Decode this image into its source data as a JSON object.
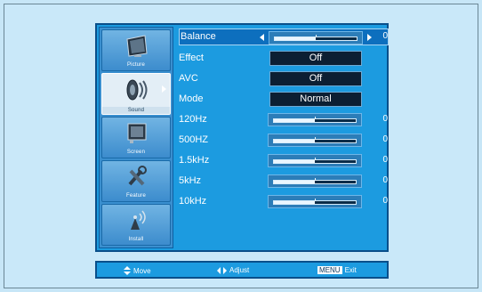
{
  "sidebar": {
    "items": [
      {
        "label": "Picture",
        "icon": "picture-icon"
      },
      {
        "label": "Sound",
        "icon": "sound-icon"
      },
      {
        "label": "Screen",
        "icon": "screen-icon"
      },
      {
        "label": "Feature",
        "icon": "feature-icon"
      },
      {
        "label": "Install",
        "icon": "install-icon"
      }
    ]
  },
  "menu": {
    "balance": {
      "label": "Balance",
      "value": "0",
      "level": 0.5
    },
    "effect": {
      "label": "Effect",
      "value": "Off"
    },
    "avc": {
      "label": "AVC",
      "value": "Off"
    },
    "mode": {
      "label": "Mode",
      "value": "Normal"
    },
    "eq": [
      {
        "label": "120Hz",
        "value": "0",
        "level": 0.5
      },
      {
        "label": "500HZ",
        "value": "0",
        "level": 0.5
      },
      {
        "label": "1.5kHz",
        "value": "0",
        "level": 0.5
      },
      {
        "label": "5kHz",
        "value": "0",
        "level": 0.5
      },
      {
        "label": "10kHz",
        "value": "0",
        "level": 0.5
      }
    ]
  },
  "footer": {
    "move": "Move",
    "adjust": "Adjust",
    "menu_key": "MENU",
    "exit": "Exit"
  }
}
